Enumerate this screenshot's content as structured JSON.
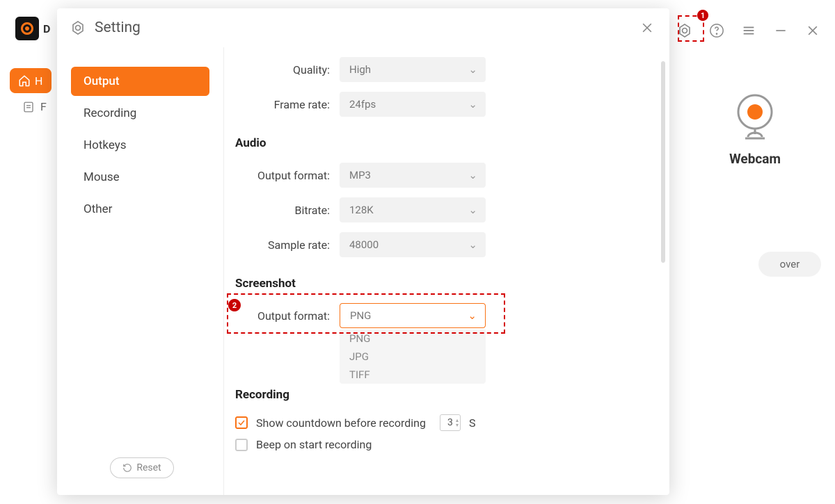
{
  "app": {
    "initial": "D"
  },
  "bg": {
    "home_label": "H",
    "file_label": "F",
    "webcam_label": "Webcam",
    "voiceover_label": "over"
  },
  "callouts": {
    "marker1": "1",
    "marker2": "2"
  },
  "dialog": {
    "title": "Setting",
    "sidebar": {
      "items": [
        {
          "label": "Output",
          "active": true
        },
        {
          "label": "Recording",
          "active": false
        },
        {
          "label": "Hotkeys",
          "active": false
        },
        {
          "label": "Mouse",
          "active": false
        },
        {
          "label": "Other",
          "active": false
        }
      ],
      "reset_label": "Reset"
    },
    "video": {
      "quality_label": "Quality:",
      "quality_value": "High",
      "framerate_label": "Frame rate:",
      "framerate_value": "24fps"
    },
    "audio": {
      "header": "Audio",
      "format_label": "Output format:",
      "format_value": "MP3",
      "bitrate_label": "Bitrate:",
      "bitrate_value": "128K",
      "samplerate_label": "Sample rate:",
      "samplerate_value": "48000"
    },
    "screenshot": {
      "header": "Screenshot",
      "format_label": "Output format:",
      "format_value": "PNG",
      "options": [
        "PNG",
        "JPG",
        "TIFF"
      ]
    },
    "recording": {
      "header": "Recording",
      "countdown_label": "Show countdown before recording",
      "countdown_value": "3",
      "countdown_unit": "S",
      "beep_label": "Beep on start recording"
    }
  }
}
